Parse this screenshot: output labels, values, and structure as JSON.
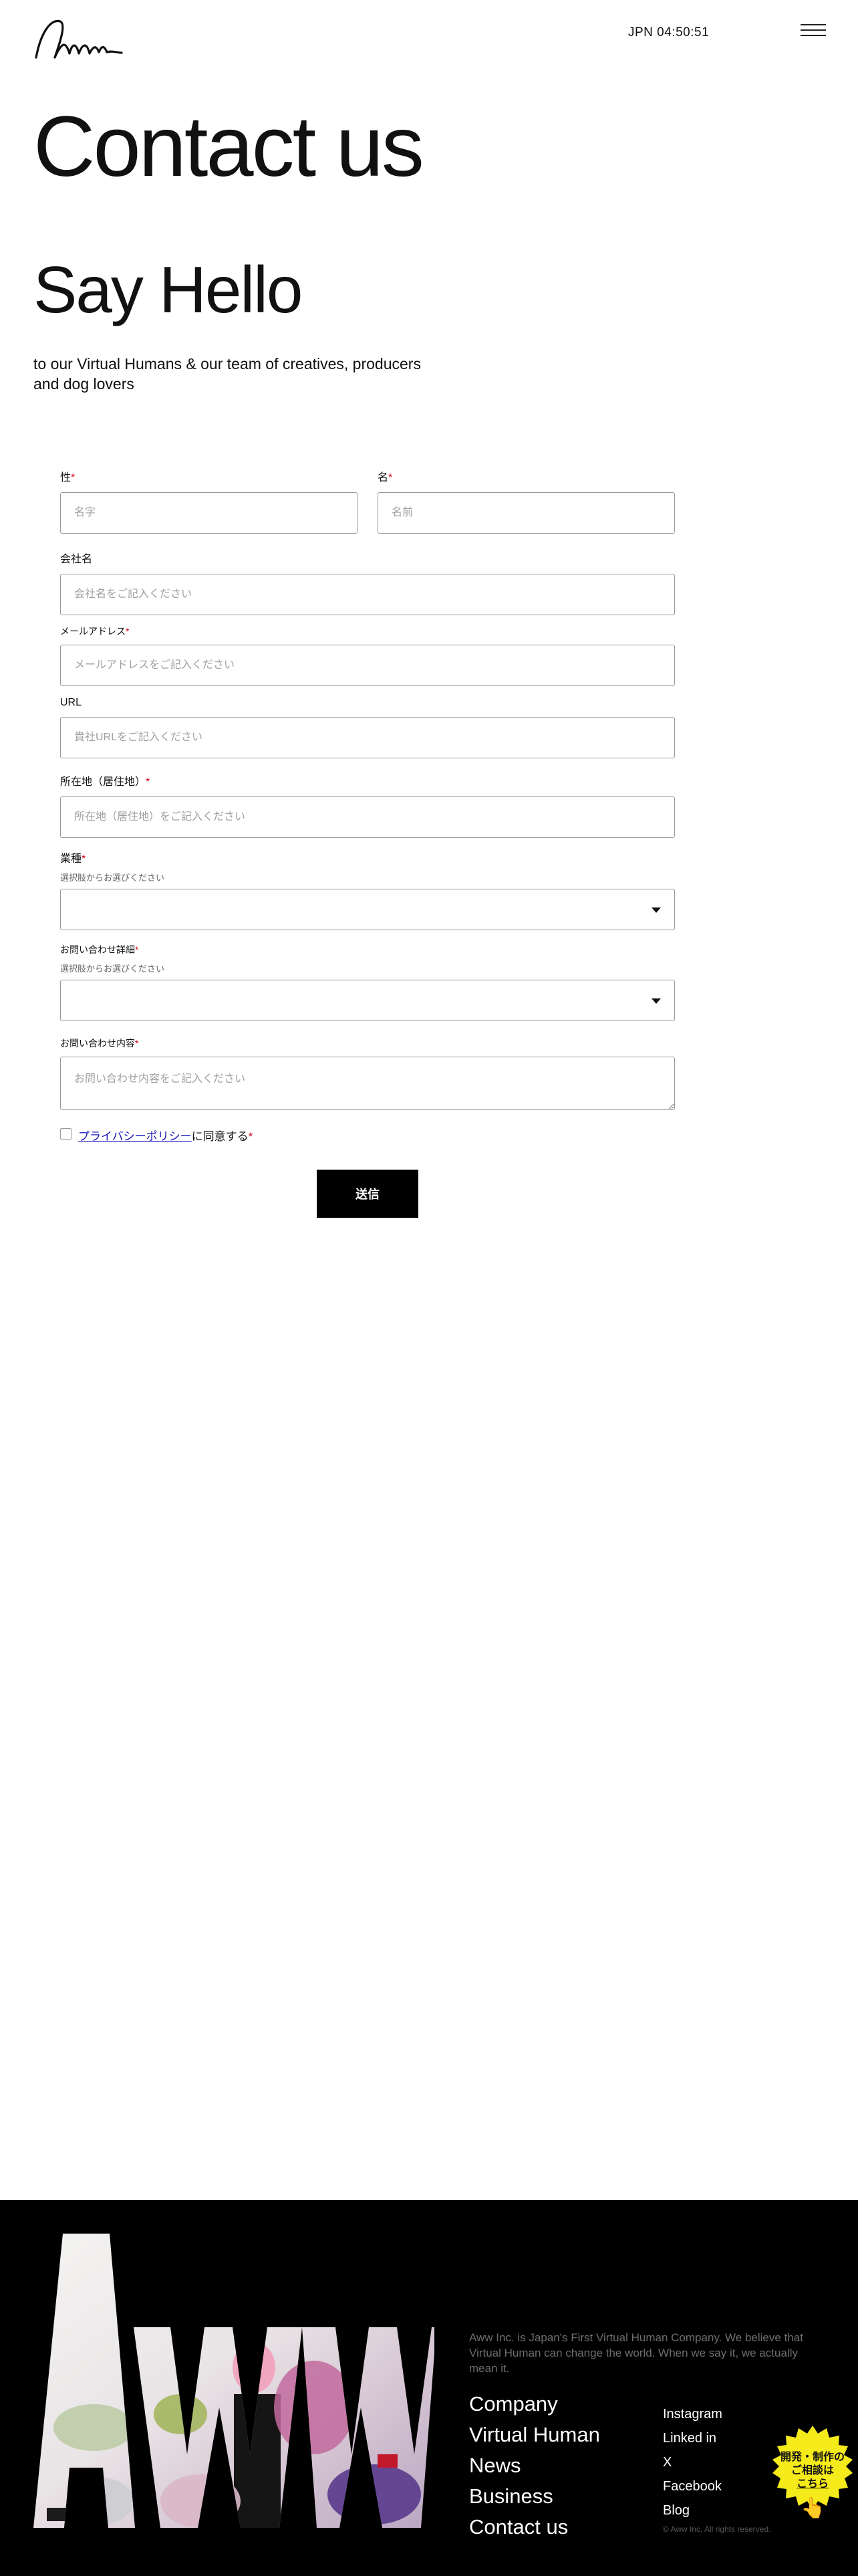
{
  "header": {
    "clock": "JPN 04:50:51",
    "menu_icon": "hamburger-icon",
    "logo_icon": "aww-signature-logo"
  },
  "hero": {
    "title": "Contact us",
    "subtitle": "Say Hello",
    "intro": "to our Virtual Humans & our team of creatives, producers and dog lovers"
  },
  "form": {
    "last_name": {
      "label": "性",
      "placeholder": "名字"
    },
    "first_name": {
      "label": "名",
      "placeholder": "名前"
    },
    "company": {
      "label": "会社名",
      "placeholder": "会社名をご記入ください"
    },
    "email": {
      "label": "メールアドレス",
      "placeholder": "メールアドレスをご記入ください"
    },
    "url": {
      "label": "URL",
      "placeholder": "貴社URLをご記入ください"
    },
    "address": {
      "label": "所在地（居住地）",
      "placeholder": "所在地（居住地）をご記入ください"
    },
    "industry": {
      "label": "業種",
      "help": "選択肢からお選びください",
      "value": ""
    },
    "inquiry_type": {
      "label": "お問い合わせ詳細",
      "help": "選択肢からお選びください",
      "value": ""
    },
    "message": {
      "label": "お問い合わせ内容",
      "placeholder": "お問い合わせ内容をご記入ください"
    },
    "required_mark": "*",
    "privacy": {
      "link_text": "プライバシーポリシー",
      "suffix": "に同意する",
      "checked": false
    },
    "submit_label": "送信"
  },
  "footer": {
    "big_logo_text": "AWW",
    "tagline": "Aww Inc. is Japan's First Virtual Human Company. We believe that Virtual Human can change the world. When we say it, we actually mean it.",
    "main_links": [
      "Company",
      "Virtual Human",
      "News",
      "Business",
      "Contact us"
    ],
    "social_links": [
      "Instagram",
      "Linked in",
      "X",
      "Facebook",
      "Blog"
    ],
    "copyright": "© Aww Inc. All rights reserved.",
    "consult_badge": {
      "line1": "開発・制作の",
      "line2": "ご相談は",
      "line3": "こちら",
      "icon": "pointing-hand-icon"
    }
  },
  "colors": {
    "accent_required": "#d0021b",
    "badge_yellow": "#f5ea1a",
    "footer_bg": "#000000",
    "link_blue": "#1a1ab8"
  }
}
